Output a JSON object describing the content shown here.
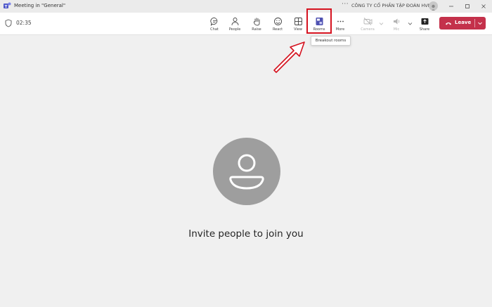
{
  "window": {
    "title": "Meeting in \"General\"",
    "org_name": "CÔNG TY CỔ PHẦN TẬP ĐOÀN HVN",
    "more": "···"
  },
  "toolbar": {
    "timer": "02:35",
    "buttons": [
      {
        "label": "Chat",
        "icon": "chat-icon"
      },
      {
        "label": "People",
        "icon": "people-icon"
      },
      {
        "label": "Raise",
        "icon": "raise-hand-icon"
      },
      {
        "label": "React",
        "icon": "react-icon"
      },
      {
        "label": "View",
        "icon": "view-icon"
      },
      {
        "label": "Rooms",
        "icon": "rooms-icon"
      },
      {
        "label": "More",
        "icon": "more-icon"
      },
      {
        "label": "Camera",
        "icon": "camera-icon"
      },
      {
        "label": "Mic",
        "icon": "mic-icon"
      },
      {
        "label": "Share",
        "icon": "share-icon"
      }
    ],
    "leave_label": "Leave"
  },
  "tooltip": "Breakout rooms",
  "main": {
    "invite_text": "Invite people to join you"
  },
  "colors": {
    "leave": "#c4314b",
    "highlight": "#d5121f",
    "rooms_icon": "#4f52b2",
    "avatar": "#9e9e9e"
  }
}
